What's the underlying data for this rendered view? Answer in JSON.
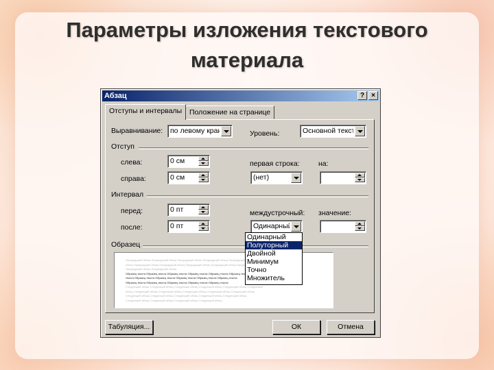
{
  "slide": {
    "title": "Параметры изложения текстового материала"
  },
  "dialog": {
    "title": "Абзац",
    "help_btn": "?",
    "close_btn": "×",
    "tabs": [
      {
        "label": "Отступы и интервалы",
        "active": true
      },
      {
        "label": "Положение на странице",
        "active": false
      }
    ],
    "alignment": {
      "label": "Выравнивание:",
      "value": "по левому краю"
    },
    "level": {
      "label": "Уровень:",
      "value": "Основной текст"
    },
    "indent": {
      "group": "Отступ",
      "left_label": "слева:",
      "left_value": "0 см",
      "right_label": "справа:",
      "right_value": "0 см",
      "first_line_label": "первая строка:",
      "first_line_value": "(нет)",
      "by_label": "на:",
      "by_value": ""
    },
    "spacing": {
      "group": "Интервал",
      "before_label": "перед:",
      "before_value": "0 пт",
      "after_label": "после:",
      "after_value": "0 пт",
      "line_label": "междустрочный:",
      "line_value": "Одинарный",
      "at_label": "значение:",
      "at_value": ""
    },
    "line_options": [
      "Одинарный",
      "Полуторный",
      "Двойной",
      "Минимум",
      "Точно",
      "Множитель"
    ],
    "line_selected_index": 1,
    "preview": {
      "label": "Образец",
      "lines": [
        "Предыдущий абзац Предыдущий абзац Предыдущий абзац Предыдущий абзац Предыдущий абзац Предыдущий",
        "абзац Предыдущий абзац Предыдущий абзац Предыдущий абзац Предыдущий абзац Предыдущий абзац",
        "Предыдущий абзац Предыдущий абзац",
        "Образец текста Образец текста Образец текста Образец текста Образец текста Образец текста",
        "текста Образец текста Образец текста Образец текста Образец текста Образец текста",
        "Образец текста Образец текста Образец текста Образец текста Образец текста",
        "Следующий абзац Следующий абзац Следующий абзац Следующий абзац Следующий абзац Следующий",
        "абзац Следующий абзац Следующий абзац Следующий абзац Следующий абзац Следующий абзац",
        "Следующий абзац Следующий абзац Следующий абзац Следующий абзац Следующий абзац",
        "Следующий абзац Следующий абзац Следующий абзац Следующий абзац"
      ]
    },
    "tabs_button": "Табуляция...",
    "ok_button": "ОК",
    "cancel_button": "Отмена"
  }
}
